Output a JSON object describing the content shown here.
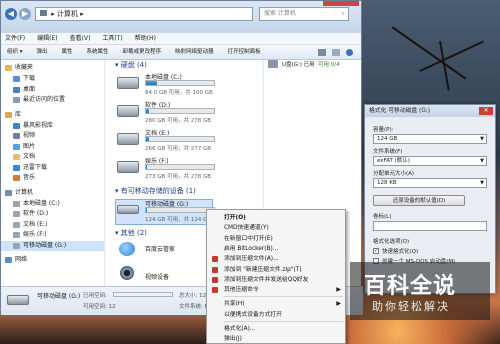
{
  "window": {
    "breadcrumb": "▸ 计算机 ▸",
    "search_placeholder": "搜索 计算机"
  },
  "menu": [
    "文件(F)",
    "编辑(E)",
    "查看(V)",
    "工具(T)",
    "帮助(H)"
  ],
  "toolbar": [
    "组织 ▾",
    "弹出",
    "属性",
    "系统属性",
    "卸载或更改程序",
    "映射网络驱动器",
    "打开控制面板"
  ],
  "sidebar": [
    {
      "label": "收藏夹",
      "group": true,
      "color": "#e8b84a"
    },
    {
      "label": "下载",
      "color": "#5b8ed6"
    },
    {
      "label": "桌面",
      "color": "#4a7fc6"
    },
    {
      "label": "最近访问的位置",
      "color": "#8a9aae"
    },
    {
      "label": "库",
      "group": true,
      "color": "#d9a94a"
    },
    {
      "label": "暴风影视库",
      "color": "#3a82d6"
    },
    {
      "label": "视频",
      "color": "#6a7cb8"
    },
    {
      "label": "图片",
      "color": "#5aa0d8"
    },
    {
      "label": "文档",
      "color": "#e0c070"
    },
    {
      "label": "迅雷下载",
      "color": "#3a86d0"
    },
    {
      "label": "音乐",
      "color": "#d07a3a"
    },
    {
      "label": "计算机",
      "group": true,
      "color": "#7a8a9e"
    },
    {
      "label": "本地磁盘 (C:)",
      "color": "#9aa4b0"
    },
    {
      "label": "软件 (D:)",
      "color": "#9aa4b0"
    },
    {
      "label": "文档 (E:)",
      "color": "#9aa4b0"
    },
    {
      "label": "娱乐 (F:)",
      "color": "#9aa4b0"
    },
    {
      "label": "可移动磁盘 (G:)",
      "color": "#9aa4b0",
      "selected": true
    },
    {
      "label": "网络",
      "group": true,
      "color": "#5a8ac8"
    }
  ],
  "sections": {
    "hard_disks": "▾ 硬盘 (4)",
    "removable": "▾ 有可移动存储的设备 (1)",
    "other": "▾ 其他 (2)"
  },
  "drives": [
    {
      "name": "本地磁盘 (C:)",
      "free": "84.0 GB 可用，共 100 GB",
      "used": 0.16
    },
    {
      "name": "软件 (D:)",
      "free": "280 GB 可用，共 278 GB",
      "used": 0.05
    },
    {
      "name": "文档 (E:)",
      "free": "266 GB 可用，共 277 GB",
      "used": 0.04
    },
    {
      "name": "娱乐 (F:)",
      "free": "273 GB 可用，共 278 GB",
      "used": 0.02
    }
  ],
  "removable_drive": {
    "name": "可移动磁盘 (G:)",
    "free": "124 GB 可用，共 124 GB",
    "used": 0.01
  },
  "other_items": [
    "百度云管家",
    "视频设备"
  ],
  "right_pane": {
    "drive_label": "U盘(G:) 已用",
    "free_label": "可用 0/4"
  },
  "status": {
    "name": "可移动磁盘 (G:)",
    "used_label": "已用空间:",
    "total_label": "总大小: 124 GB",
    "free_label": "可用空间: 12",
    "fs_label": "文件系统: FA"
  },
  "context_menu": [
    {
      "label": "打开(O)",
      "bold": true
    },
    {
      "label": "CMD快速通道(Y)"
    },
    {
      "label": "在新窗口中打开(E)"
    },
    {
      "label": "启用 BitLocker(B)..."
    },
    {
      "label": "添加到压缩文件(A)...",
      "icon": "#c0392b"
    },
    {
      "label": "添加到 \"新建压缩文件.zip\"(T)",
      "icon": "#c0392b"
    },
    {
      "label": "添加到压缩文件并发送给QQ好友",
      "icon": "#c0392b"
    },
    {
      "label": "其他压缩命令",
      "icon": "#c0392b",
      "submenu": true
    },
    {
      "label": "共享(H)",
      "submenu": true,
      "sep_before": true
    },
    {
      "label": "以便携式设备方式打开"
    },
    {
      "label": "格式化(A)...",
      "sep_before": true
    },
    {
      "label": "弹出(J)"
    }
  ],
  "format_dialog": {
    "title": "格式化 可移动磁盘 (G:)",
    "close": "✕",
    "capacity_label": "容量(P):",
    "capacity_value": "124 GB",
    "fs_label": "文件系统(F)",
    "fs_value": "exFAT (默认)",
    "alloc_label": "分配单元大小(A)",
    "alloc_value": "128 KB",
    "restore_button": "还原设备的默认值(D)",
    "volume_label": "卷标(L)",
    "volume_value": "",
    "options_label": "格式化选项(O)",
    "quick_format": "快速格式化(Q)",
    "quick_checked": true,
    "msdos_disk": "创建一个 MS-DOS 启动盘(M)",
    "msdos_checked": false
  },
  "watermark": {
    "line1": "百科全说",
    "line2": "助你轻松解决"
  }
}
